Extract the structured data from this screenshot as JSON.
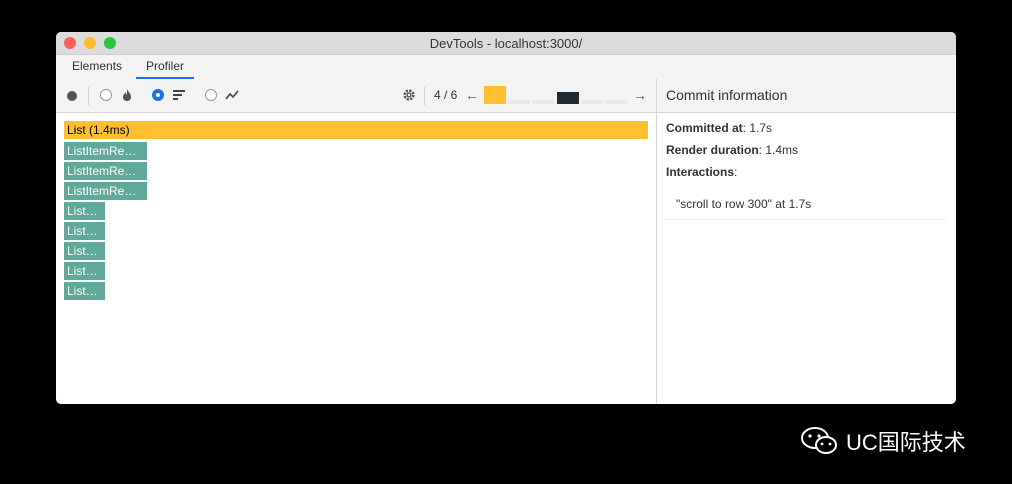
{
  "window": {
    "title": "DevTools - localhost:3000/"
  },
  "tabs": [
    {
      "label": "Elements"
    },
    {
      "label": "Profiler",
      "active": true
    }
  ],
  "toolbar": {
    "commit_counter": "4 / 6",
    "commit_colors": [
      "#ffbf2f",
      "#e8e8e8",
      "#e8e8e8",
      "#1f2a33",
      "#e8e8e8",
      "#e8e8e8"
    ],
    "selected_commit_index": 3
  },
  "flamegraph": {
    "root": {
      "label": "List (1.4ms)"
    },
    "children": [
      {
        "label": "ListItemRe…"
      },
      {
        "label": "ListItemRe…"
      },
      {
        "label": "ListItemRe…"
      },
      {
        "label": "List…"
      },
      {
        "label": "List…"
      },
      {
        "label": "List…"
      },
      {
        "label": "List…"
      },
      {
        "label": "List…"
      }
    ]
  },
  "commit_panel": {
    "heading": "Commit information",
    "committed_at_label": "Committed at",
    "committed_at_value": ": 1.7s",
    "render_duration_label": "Render duration",
    "render_duration_value": ": 1.4ms",
    "interactions_label": "Interactions",
    "interactions_colon": ":",
    "interaction_item": "\"scroll to row 300\" at 1.7s"
  },
  "watermark": {
    "text": "UC国际技术"
  },
  "colors": {
    "accent": "#1a73e8",
    "root_bar": "#ffbf2f",
    "child_bar": "#5fa89a"
  }
}
